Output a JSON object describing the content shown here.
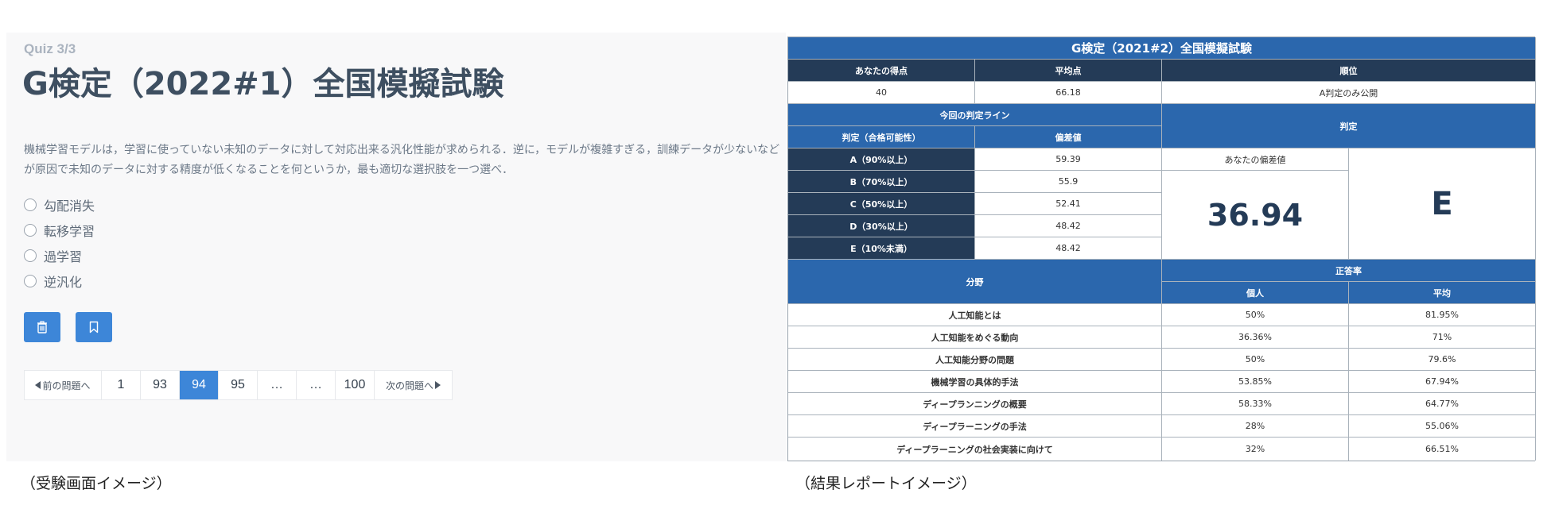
{
  "quiz": {
    "counter": "Quiz 3/3",
    "title": "G検定（2022#1）全国模擬試験",
    "question": "機械学習モデルは，学習に使っていない未知のデータに対して対応出来る汎化性能が求められる．逆に，モデルが複雑すぎる，訓練データが少ないなどが原因で未知のデータに対する精度が低くなることを何というか，最も適切な選択肢を一つ選べ．",
    "options": [
      "勾配消失",
      "転移学習",
      "過学習",
      "逆汎化"
    ],
    "buttons": {
      "delete_icon": "trash-icon",
      "bookmark_icon": "bookmark-icon"
    },
    "pagination": {
      "prev": "前の問題へ",
      "pages": [
        "1",
        "93",
        "94",
        "95",
        "…",
        "…",
        "100"
      ],
      "active": "94",
      "next": "次の問題へ"
    }
  },
  "captions": {
    "left": "（受験画面イメージ）",
    "right": "（結果レポートイメージ）"
  },
  "report": {
    "title": "G検定（2021#2）全国模擬試験",
    "headers": {
      "your_score": "あなたの得点",
      "average": "平均点",
      "rank": "順位"
    },
    "values": {
      "your_score": "40",
      "average": "66.18",
      "rank": "A判定のみ公開"
    },
    "line_section": {
      "title": "今回の判定ライン",
      "col_judge": "判定（合格可能性）",
      "col_dev": "偏差値",
      "rows": [
        {
          "label": "A（90%以上）",
          "value": "59.39"
        },
        {
          "label": "B（70%以上）",
          "value": "55.9"
        },
        {
          "label": "C（50%以上）",
          "value": "52.41"
        },
        {
          "label": "D（30%以上）",
          "value": "48.42"
        },
        {
          "label": "E（10%未満）",
          "value": "48.42"
        }
      ]
    },
    "judgement": {
      "title": "判定",
      "your_dev_label": "あなたの偏差値",
      "your_dev": "36.94",
      "grade": "E"
    },
    "fields": {
      "col_field": "分野",
      "col_rate": "正答率",
      "col_personal": "個人",
      "col_avg": "平均",
      "rows": [
        {
          "name": "人工知能とは",
          "personal": "50%",
          "avg": "81.95%"
        },
        {
          "name": "人工知能をめぐる動向",
          "personal": "36.36%",
          "avg": "71%"
        },
        {
          "name": "人工知能分野の問題",
          "personal": "50%",
          "avg": "79.6%"
        },
        {
          "name": "機械学習の具体的手法",
          "personal": "53.85%",
          "avg": "67.94%"
        },
        {
          "name": "ディープランニングの概要",
          "personal": "58.33%",
          "avg": "64.77%"
        },
        {
          "name": "ディープラーニングの手法",
          "personal": "28%",
          "avg": "55.06%"
        },
        {
          "name": "ディープラーニングの社会実装に向けて",
          "personal": "32%",
          "avg": "66.51%"
        }
      ]
    }
  },
  "colors": {
    "accent": "#3d86d8",
    "report_blue": "#2b67ad",
    "report_dark": "#243b57"
  }
}
